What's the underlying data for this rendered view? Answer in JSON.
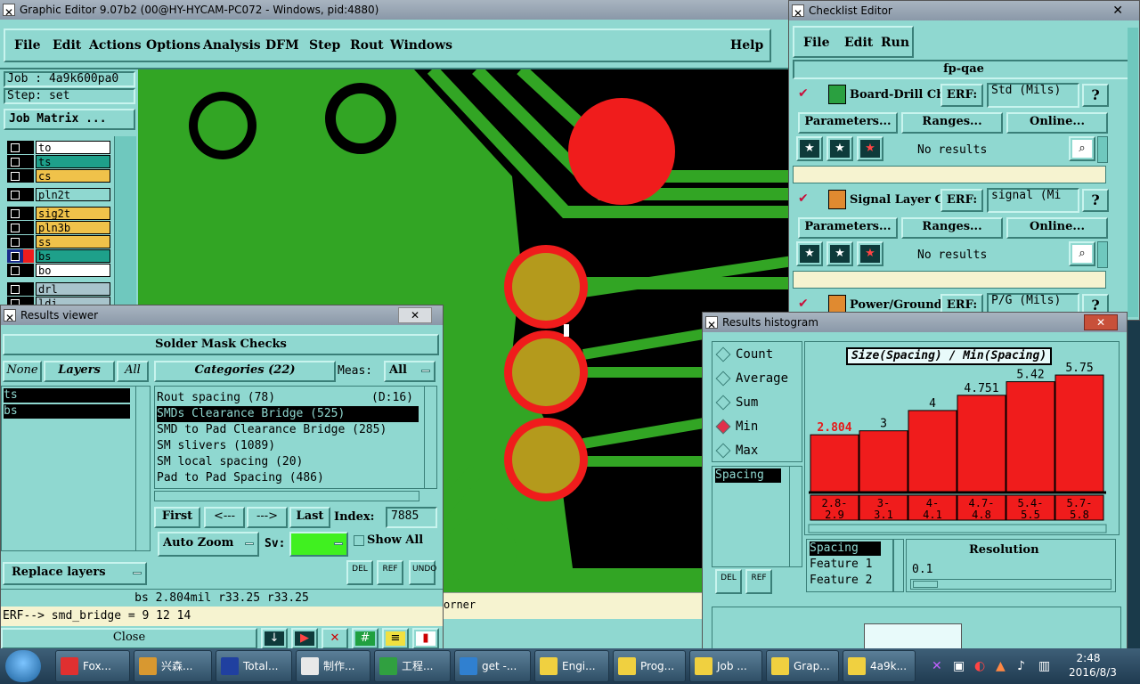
{
  "main_window": {
    "title": "Graphic Editor 9.07b2 (00@HY-HYCAM-PC072 - Windows, pid:4880)",
    "menu": [
      "File",
      "Edit",
      "Actions",
      "Options",
      "Analysis",
      "DFM",
      "Step",
      "Rout",
      "Windows"
    ],
    "help": "Help",
    "job": "Job : 4a9k600pa0",
    "step": "Step: set",
    "job_matrix": "Job Matrix ...",
    "layers": [
      {
        "name": "to",
        "color": "#ffffff"
      },
      {
        "name": "ts",
        "color": "#1ea08a"
      },
      {
        "name": "cs",
        "color": "#f0c24a"
      },
      {
        "name": "pln2t",
        "color": "#8fd8d0"
      },
      {
        "name": "sig2t",
        "color": "#f0c24a"
      },
      {
        "name": "pln3b",
        "color": "#f0c24a"
      },
      {
        "name": "ss",
        "color": "#f0c24a"
      },
      {
        "name": "bs",
        "color": "#1ea08a"
      },
      {
        "name": "bo",
        "color": "#ffffff"
      },
      {
        "name": "drl",
        "color": "#a8c4cc"
      },
      {
        "name": "ldi",
        "color": "#a8c4cc"
      }
    ],
    "status_fragment": "orner"
  },
  "checklist_editor": {
    "title": "Checklist Editor",
    "menu": [
      "File",
      "Edit",
      "Run"
    ],
    "checklist_name": "fp-qae",
    "checks": [
      {
        "name": "Board-Drill Che",
        "erf_label": "ERF:",
        "erf_value": "Std (Mils)",
        "results": "No results"
      },
      {
        "name": "Signal Layer Ch",
        "erf_label": "ERF:",
        "erf_value": "signal (Mi",
        "results": "No results"
      },
      {
        "name": "Power/Ground C",
        "erf_label": "ERF:",
        "erf_value": "P/G (Mils)",
        "results": ""
      }
    ],
    "buttons": {
      "parameters": "Parameters...",
      "ranges": "Ranges...",
      "online": "Online..."
    }
  },
  "results_viewer": {
    "title": "Results viewer",
    "heading": "Solder Mask Checks",
    "none_btn": "None",
    "layers_btn": "Layers",
    "all_btn": "All",
    "categories_btn": "Categories (22)",
    "meas_label": "Meas:",
    "meas_value": "All",
    "layer_items": [
      "ts",
      "bs"
    ],
    "categories": [
      {
        "text": "Rout spacing (78)",
        "extra": "(D:16)",
        "selected": false
      },
      {
        "text": "SMDs Clearance Bridge (525)",
        "extra": "",
        "selected": true
      },
      {
        "text": "SMD to Pad Clearance Bridge (285)",
        "extra": "",
        "selected": false
      },
      {
        "text": "SM slivers (1089)",
        "extra": "",
        "selected": false
      },
      {
        "text": "SM local spacing (20)",
        "extra": "",
        "selected": false
      },
      {
        "text": "Pad to Pad Spacing (486)",
        "extra": "",
        "selected": false
      }
    ],
    "nav": {
      "first": "First",
      "prev": "<---",
      "next": "--->",
      "last": "Last",
      "index_label": "Index:",
      "index_value": "7885"
    },
    "auto_zoom": "Auto Zoom",
    "sv_label": "Sv:",
    "show_all": "Show All",
    "replace_layers": "Replace layers",
    "tools": {
      "del": "DEL",
      "ref": "REF",
      "undo": "UNDO"
    },
    "measure": "bs 2.804mil  r33.25  r33.25",
    "erf_line": "ERF--> smd_bridge = 9 12 14",
    "close": "Close"
  },
  "histogram": {
    "title": "Results histogram",
    "modes": [
      {
        "label": "Count",
        "selected": false
      },
      {
        "label": "Average",
        "selected": false
      },
      {
        "label": "Sum",
        "selected": false
      },
      {
        "label": "Min",
        "selected": true
      },
      {
        "label": "Max",
        "selected": false
      }
    ],
    "chart_title": "Size(Spacing) / Min(Spacing)",
    "list_item": "Spacing",
    "attr_items": [
      "Spacing",
      "Feature 1",
      "Feature 2"
    ],
    "resolution_label": "Resolution",
    "resolution_value": "0.1",
    "tools": {
      "del": "DEL",
      "ref": "REF"
    }
  },
  "chart_data": {
    "type": "bar",
    "title": "Size(Spacing) / Min(Spacing)",
    "categories": [
      "2.8-\n2.9",
      "3-\n3.1",
      "4-\n4.1",
      "4.7-\n4.8",
      "5.4-\n5.5",
      "5.7-\n5.8"
    ],
    "category_top": [
      "2.8-",
      "3-",
      "4-",
      "4.7-",
      "5.4-",
      "5.7-"
    ],
    "category_bottom": [
      "2.9",
      "3.1",
      "4.1",
      "4.8",
      "5.5",
      "5.8"
    ],
    "values": [
      2.804,
      3,
      4,
      4.751,
      5.42,
      5.75
    ],
    "value_labels": [
      "2.804",
      "3",
      "4",
      "4.751",
      "5.42",
      "5.75"
    ],
    "label_colors": [
      "#e81818",
      "#000000",
      "#000000",
      "#000000",
      "#000000",
      "#000000"
    ],
    "bar_color": "#f01c1c",
    "ylim": [
      0,
      6.5
    ]
  },
  "taskbar": {
    "tasks": [
      "Fox...",
      "兴森...",
      "Total...",
      "制作...",
      "工程...",
      "get -...",
      "Engi...",
      "Prog...",
      "Job ...",
      "Grap...",
      "4a9k..."
    ],
    "time": "2:48",
    "date": "2016/8/3"
  }
}
